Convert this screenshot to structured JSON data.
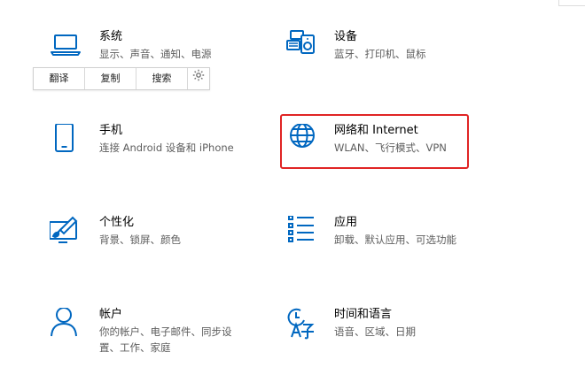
{
  "accent_color": "#0067c0",
  "highlight_color": "#e02424",
  "tiles": {
    "system": {
      "icon": "laptop-icon",
      "title": "系统",
      "desc": "显示、声音、通知、电源"
    },
    "devices": {
      "icon": "keyboard-speaker-icon",
      "title": "设备",
      "desc": "蓝牙、打印机、鼠标"
    },
    "phone": {
      "icon": "phone-icon",
      "title": "手机",
      "desc": "连接 Android 设备和 iPhone"
    },
    "network": {
      "icon": "globe-icon",
      "title": "网络和 Internet",
      "desc": "WLAN、飞行模式、VPN"
    },
    "personalization": {
      "icon": "paint-monitor-icon",
      "title": "个性化",
      "desc": "背景、锁屏、颜色"
    },
    "apps": {
      "icon": "app-list-icon",
      "title": "应用",
      "desc": "卸载、默认应用、可选功能"
    },
    "accounts": {
      "icon": "person-icon",
      "title": "帐户",
      "desc": "你的帐户、电子邮件、同步设",
      "desc2": "置、工作、家庭"
    },
    "time_language": {
      "icon": "clock-language-icon",
      "title": "时间和语言",
      "desc": "语音、区域、日期"
    }
  },
  "context_toolbar": {
    "translate": "翻译",
    "copy": "复制",
    "search": "搜索",
    "settings_icon": "gear-icon"
  }
}
